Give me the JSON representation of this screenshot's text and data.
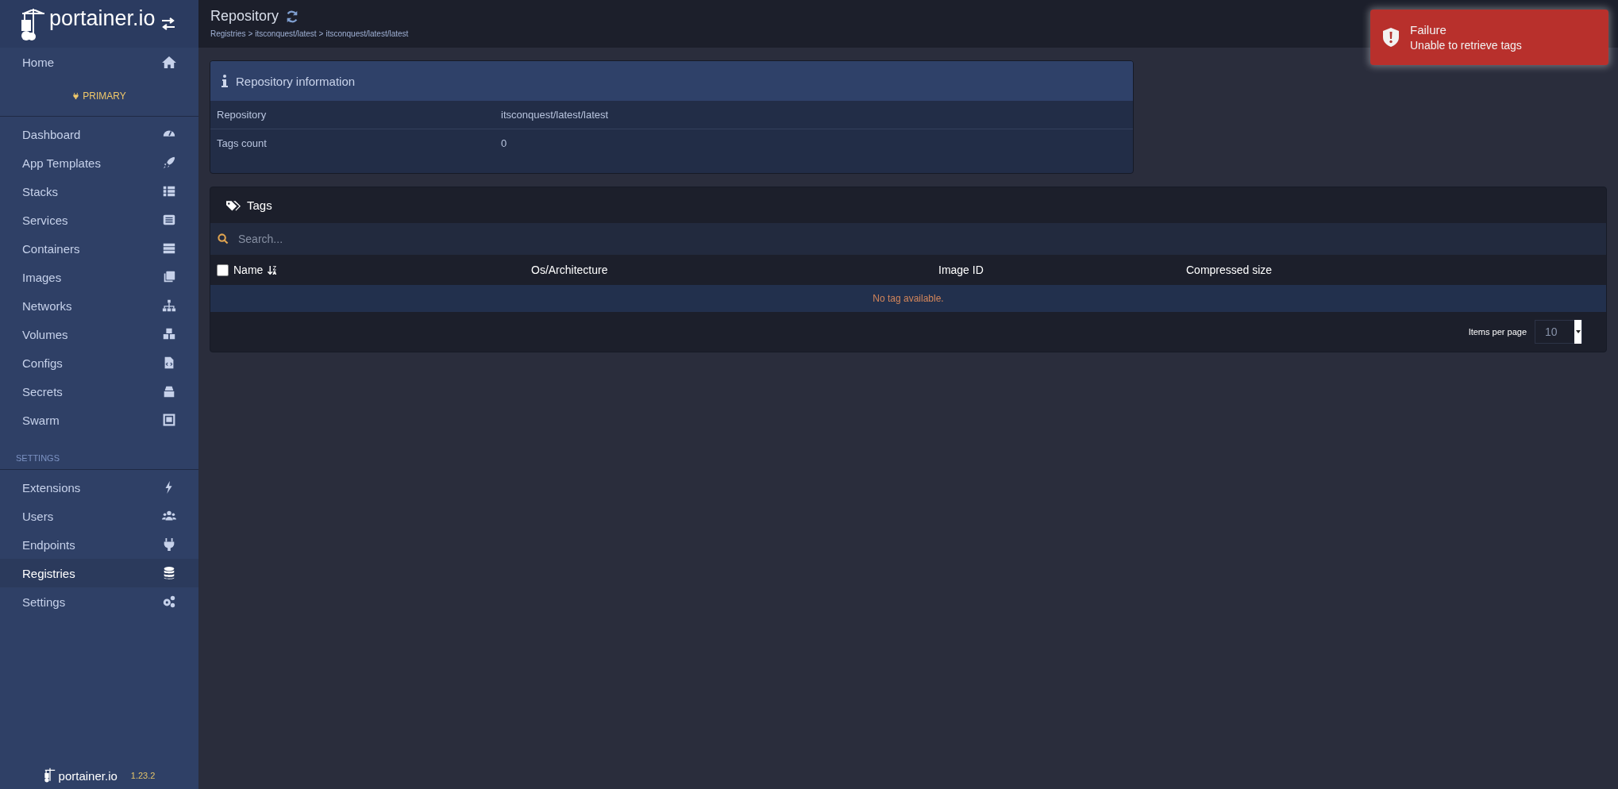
{
  "sidebar": {
    "logo": "portainer.io",
    "home": {
      "label": "Home",
      "selected": false
    },
    "endpoint": "PRIMARY",
    "items": [
      {
        "label": "Dashboard",
        "selected": false
      },
      {
        "label": "App Templates",
        "selected": false
      },
      {
        "label": "Stacks",
        "selected": false
      },
      {
        "label": "Services",
        "selected": false
      },
      {
        "label": "Containers",
        "selected": false
      },
      {
        "label": "Images",
        "selected": false
      },
      {
        "label": "Networks",
        "selected": false
      },
      {
        "label": "Volumes",
        "selected": false
      },
      {
        "label": "Configs",
        "selected": false
      },
      {
        "label": "Secrets",
        "selected": false
      },
      {
        "label": "Swarm",
        "selected": false
      }
    ],
    "settings_title": "SETTINGS",
    "settings_items": [
      {
        "label": "Extensions",
        "selected": false
      },
      {
        "label": "Users",
        "selected": false
      },
      {
        "label": "Endpoints",
        "selected": false
      },
      {
        "label": "Registries",
        "selected": true
      },
      {
        "label": "Settings",
        "selected": false
      }
    ],
    "footer": {
      "logo": "portainer.io",
      "version": "1.23.2"
    }
  },
  "header": {
    "title": "Repository",
    "breadcrumbs": [
      "Registries",
      "itsconquest/latest",
      "itsconquest/latest/latest"
    ],
    "breadcrumb_separator": ">"
  },
  "toast": {
    "title": "Failure",
    "message": "Unable to retrieve tags"
  },
  "repository_info": {
    "title": "Repository information",
    "rows": [
      {
        "label": "Repository",
        "value": "itsconquest/latest/latest"
      },
      {
        "label": "Tags count",
        "value": "0"
      }
    ]
  },
  "tags": {
    "title": "Tags",
    "search": {
      "placeholder": "Search..."
    },
    "select_all": {
      "checked": false
    },
    "columns": [
      "Name",
      "Os/Architecture",
      "Image ID",
      "Compressed size"
    ],
    "empty": "No tag available.",
    "items_per_page": {
      "label": "Items per page",
      "value": "10"
    }
  }
}
